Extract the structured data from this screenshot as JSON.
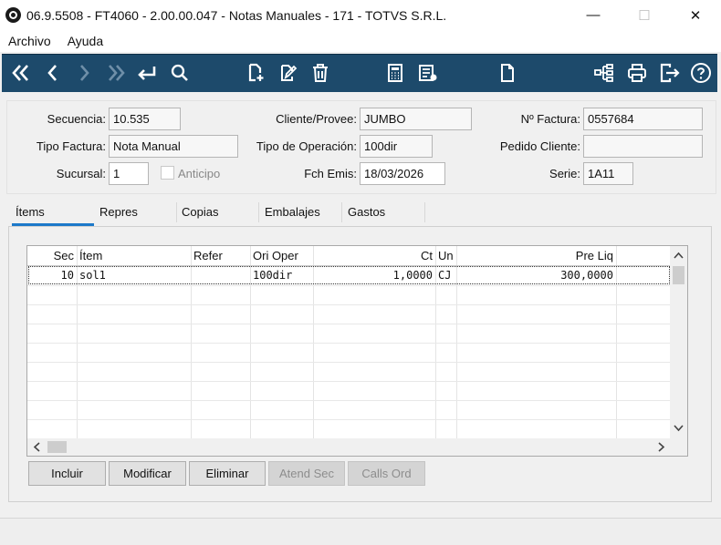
{
  "window": {
    "title": "06.9.5508 - FT4060 - 2.00.00.047 - Notas Manuales - 171 - TOTVS S.R.L.",
    "minimize": "—",
    "maximize": "☐",
    "close": "✕"
  },
  "menu": [
    "Archivo",
    "Ayuda"
  ],
  "toolbar": {
    "icons": [
      "first-record-icon",
      "previous-record-icon",
      "next-record-icon",
      "last-record-icon",
      "return-icon",
      "search-icon",
      "new-document-icon",
      "edit-document-icon",
      "delete-icon",
      "calculator-icon",
      "list-report-icon",
      "blank-document-icon",
      "hierarchy-icon",
      "print-icon",
      "exit-icon",
      "help-icon"
    ],
    "bg_color": "#1d4a6b"
  },
  "header": {
    "secuencia_label": "Secuencia:",
    "secuencia": "10.535",
    "tipo_factura_label": "Tipo Factura:",
    "tipo_factura": "Nota Manual",
    "sucursal_label": "Sucursal:",
    "sucursal": "1",
    "anticipo_label": "Anticipo",
    "cliente_label": "Cliente/Provee:",
    "cliente": "JUMBO",
    "tipo_operacion_label": "Tipo de Operación:",
    "tipo_operacion": "100dir",
    "fch_emis_label": "Fch Emis:",
    "fch_emis": "18/03/2026",
    "nro_factura_label": "Nº Factura:",
    "nro_factura": "0557684",
    "pedido_cliente_label": "Pedido Cliente:",
    "pedido_cliente": "",
    "serie_label": "Serie:",
    "serie": "1A11"
  },
  "tabs": [
    "Ítems",
    "Repres",
    "Copias",
    "Embalajes",
    "Gastos"
  ],
  "active_tab": "Ítems",
  "grid": {
    "columns": [
      "Sec",
      "Ítem",
      "Refer",
      "Ori Oper",
      "Ct",
      "Un",
      "Pre Liq"
    ],
    "rows": [
      {
        "sec": "10",
        "item": "sol1",
        "refer": "",
        "ori_oper": "100dir",
        "ct": "1,0000",
        "un": "CJ",
        "pre_liq": "300,0000"
      }
    ]
  },
  "buttons": {
    "incluir": "Incluir",
    "modificar": "Modificar",
    "eliminar": "Eliminar",
    "atend_sec": "Atend Sec",
    "calls_ord": "Calls Ord"
  },
  "accent_color": "#1c79c9"
}
